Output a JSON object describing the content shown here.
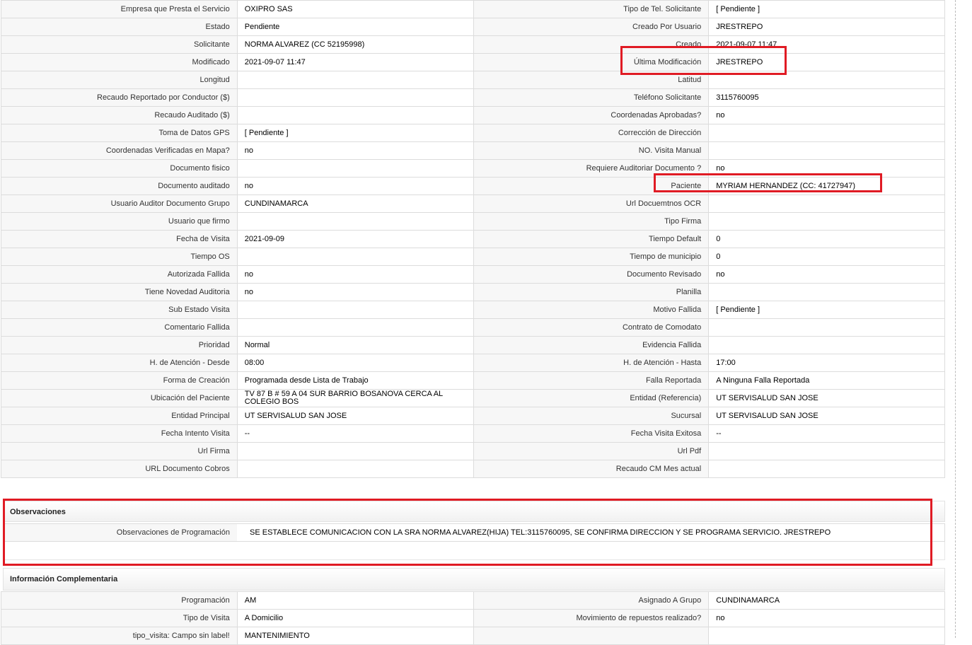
{
  "main_rows": [
    [
      "Empresa que Presta el Servicio",
      "OXIPRO SAS",
      "Tipo de Tel. Solicitante",
      "[ Pendiente ]"
    ],
    [
      "Estado",
      "Pendiente",
      "Creado Por Usuario",
      "JRESTREPO"
    ],
    [
      "Solicitante",
      "NORMA ALVAREZ (CC 52195998)",
      "Creado",
      "2021-09-07 11:47"
    ],
    [
      "Modificado",
      "2021-09-07 11:47",
      "Última Modificación",
      " JRESTREPO"
    ],
    [
      "Longitud",
      "",
      "Latitud",
      ""
    ],
    [
      "Recaudo Reportado por Conductor ($)",
      "",
      "Teléfono Solicitante",
      "3115760095"
    ],
    [
      "Recaudo Auditado ($)",
      "",
      "Coordenadas Aprobadas?",
      " no"
    ],
    [
      "Toma de Datos GPS",
      "[ Pendiente ]",
      "Corrección de Dirección",
      ""
    ],
    [
      "Coordenadas Verificadas en Mapa?",
      " no",
      "NO. Visita Manual",
      ""
    ],
    [
      "Documento fisico",
      "",
      "Requiere Auditoriar Documento ?",
      " no"
    ],
    [
      "Documento auditado",
      " no",
      "Paciente",
      "MYRIAM HERNANDEZ (CC: 41727947)"
    ],
    [
      "Usuario Auditor Documento Grupo",
      "CUNDINAMARCA",
      "Url Docuemtnos OCR",
      ""
    ],
    [
      "Usuario que firmo",
      "",
      "Tipo Firma",
      ""
    ],
    [
      "Fecha de Visita",
      " 2021-09-09",
      "Tiempo Default",
      "0"
    ],
    [
      "Tiempo OS",
      "",
      "Tiempo de municipio",
      "0"
    ],
    [
      "Autorizada Fallida",
      " no",
      "Documento Revisado",
      " no"
    ],
    [
      "Tiene Novedad Auditoria",
      " no",
      "Planilla",
      ""
    ],
    [
      "Sub Estado Visita",
      "",
      "Motivo Fallida",
      "[ Pendiente ]"
    ],
    [
      "Comentario Fallida",
      "",
      "Contrato de Comodato",
      ""
    ],
    [
      "Prioridad",
      "Normal",
      "Evidencia Fallida",
      ""
    ],
    [
      "H. de Atención - Desde",
      "08:00",
      "H. de Atención - Hasta",
      "17:00"
    ],
    [
      "Forma de Creación",
      "Programada desde Lista de Trabajo",
      "Falla Reportada",
      "A Ninguna Falla Reportada"
    ],
    [
      "Ubicación del Paciente",
      "TV 87 B # 59 A 04 SUR BARRIO BOSANOVA CERCA AL COLEGIO BOS",
      "Entidad (Referencia)",
      "UT SERVISALUD SAN JOSE"
    ],
    [
      "Entidad Principal",
      "UT SERVISALUD SAN JOSE",
      "Sucursal",
      "UT SERVISALUD SAN JOSE"
    ],
    [
      "Fecha Intento Visita",
      " --",
      "Fecha Visita Exitosa",
      " --"
    ],
    [
      "Url Firma",
      "",
      "Url Pdf",
      ""
    ],
    [
      "URL Documento Cobros",
      "",
      "Recaudo CM Mes actual",
      ""
    ]
  ],
  "observaciones": {
    "title": "Observaciones",
    "label": "Observaciones de Programación",
    "value": "SE ESTABLECE COMUNICACION CON LA SRA NORMA ALVAREZ(HIJA) TEL:3115760095, SE CONFIRMA DIRECCION Y SE PROGRAMA SERVICIO. JRESTREPO"
  },
  "complementaria": {
    "title": "Información Complementaria",
    "rows": [
      [
        "Programación",
        "AM",
        "Asignado A Grupo",
        "CUNDINAMARCA"
      ],
      [
        "Tipo de Visita",
        "A Domicilio",
        "Movimiento de repuestos realizado?",
        " no"
      ],
      [
        "tipo_visita: Campo sin label!",
        "MANTENIMIENTO",
        "",
        ""
      ]
    ]
  },
  "colors": {
    "highlight": "#e01b24",
    "label_bg": "#f7f7f7",
    "border": "#dcdcdc"
  }
}
